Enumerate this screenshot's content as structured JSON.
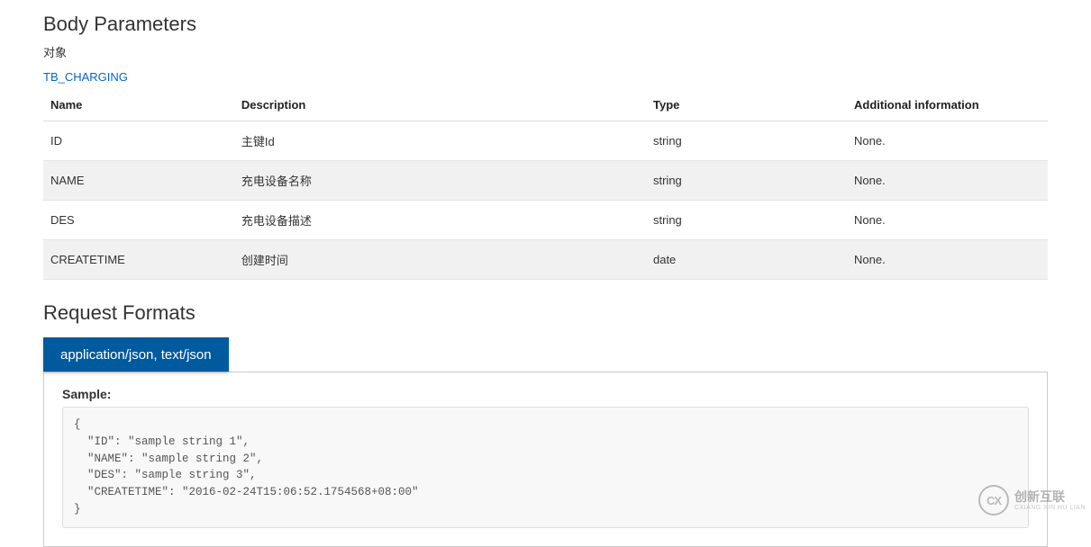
{
  "body_parameters": {
    "title": "Body Parameters",
    "subtitle": "对象",
    "model_link": "TB_CHARGING",
    "columns": {
      "name": "Name",
      "description": "Description",
      "type": "Type",
      "additional": "Additional information"
    },
    "rows": [
      {
        "name": "ID",
        "description": "主键Id",
        "type": "string",
        "additional": "None."
      },
      {
        "name": "NAME",
        "description": "充电设备名称",
        "type": "string",
        "additional": "None."
      },
      {
        "name": "DES",
        "description": "充电设备描述",
        "type": "string",
        "additional": "None."
      },
      {
        "name": "CREATETIME",
        "description": "创建时间",
        "type": "date",
        "additional": "None."
      }
    ]
  },
  "request_formats": {
    "title": "Request Formats",
    "tabs": [
      {
        "label": "application/json, text/json",
        "active": true
      }
    ],
    "sample_label": "Sample:",
    "sample_code": "{\n  \"ID\": \"sample string 1\",\n  \"NAME\": \"sample string 2\",\n  \"DES\": \"sample string 3\",\n  \"CREATETIME\": \"2016-02-24T15:06:52.1754568+08:00\"\n}"
  },
  "watermark": {
    "badge": "CX",
    "brand_cn": "创新互联",
    "brand_en": "CXIANG XIN HU LIAN"
  }
}
